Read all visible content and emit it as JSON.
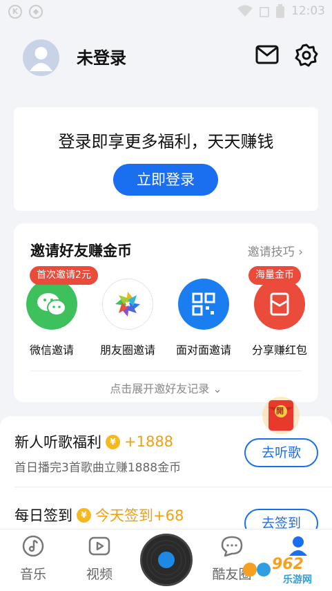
{
  "status_bar": {
    "time": "12:03"
  },
  "profile": {
    "name": "未登录"
  },
  "login_card": {
    "slogan": "登录即享更多福利，天天赚钱",
    "button": "立即登录"
  },
  "invite": {
    "title": "邀请好友赚金币",
    "tips": "邀请技巧",
    "items": [
      {
        "label": "微信邀请",
        "badge": "首次邀请2元",
        "color": "#3ec15c"
      },
      {
        "label": "朋友圈邀请",
        "badge": "",
        "color": "#ffffff"
      },
      {
        "label": "面对面邀请",
        "badge": "",
        "color": "#1a7ef0"
      },
      {
        "label": "分享赚红包",
        "badge": "海量金币",
        "color": "#ea4b3a"
      }
    ],
    "expand": "点击展开邀好友记录"
  },
  "tasks": [
    {
      "title": "新人听歌福利",
      "reward": "+1888",
      "desc": "首日播完3首歌曲立赚1888金币",
      "button": "去听歌"
    },
    {
      "title": "每日签到",
      "reward": "今天签到+68",
      "desc": "",
      "button": "去签到"
    }
  ],
  "redpacket": {
    "label": "開"
  },
  "tabbar": {
    "tabs": [
      "音乐",
      "视频",
      "酷友圈"
    ]
  },
  "watermark": {
    "text": "962",
    "sub": "乐游网"
  },
  "colors": {
    "accent": "#1a6ff0",
    "reward": "#f0a010",
    "badge": "#ea4b3a"
  }
}
